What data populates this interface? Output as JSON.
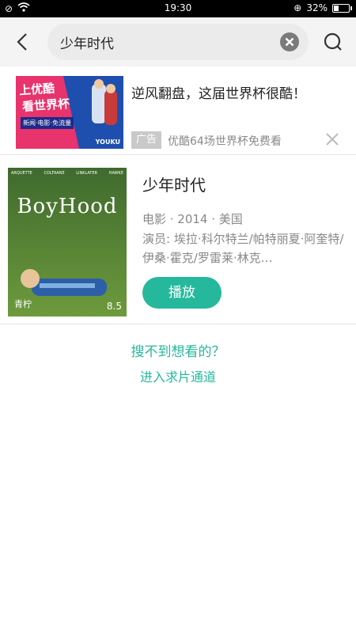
{
  "status": {
    "time": "19:30",
    "battery": "32%",
    "battery_level": 0.32
  },
  "search": {
    "query": "少年时代"
  },
  "ad": {
    "image_text": [
      "上优酷",
      "看世界杯",
      "新闻·电影·免流量",
      "YOUKU"
    ],
    "title": "逆风翻盘，这届世界杯很酷！",
    "badge": "广告",
    "subtitle": "优酷64场世界杯免费看"
  },
  "movie": {
    "poster_title": "BoyHood",
    "poster_credits": [
      "ARQUETTE",
      "COLTRANE",
      "LINKLATER",
      "HAWKE"
    ],
    "poster_tag": "青柠",
    "rating": "8.5",
    "title": "少年时代",
    "meta": "电影 · 2014 · 美国",
    "cast": "演员: 埃拉·科尔特兰/帕特丽夏·阿奎特/伊桑·霍克/罗雷莱·林克…",
    "play_label": "播放"
  },
  "not_found": {
    "question": "搜不到想看的？",
    "link": "进入求片通道"
  },
  "colors": {
    "accent": "#25b89d"
  }
}
